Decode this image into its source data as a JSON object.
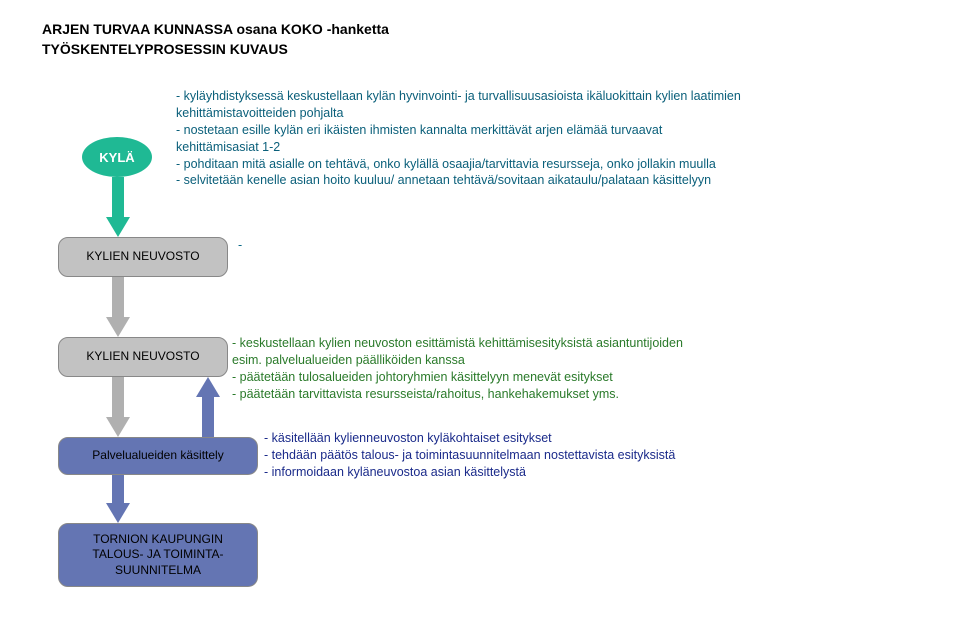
{
  "title_line1": "ARJEN TURVAA KUNNASSA osana KOKO -hanketta",
  "title_line2": "TYÖSKENTELYPROSESSIN KUVAUS",
  "nodes": {
    "kyla": "KYLÄ",
    "neuvosto1": "KYLIEN NEUVOSTO",
    "neuvosto2": "KYLIEN NEUVOSTO",
    "palvelu": "Palvelualueiden käsittely",
    "tornion_l1": "TORNION KAUPUNGIN",
    "tornion_l2": "TALOUS- JA TOIMINTA-",
    "tornion_l3": "SUUNNITELMA"
  },
  "desc": {
    "kyla_l1": "- kyläyhdistyksessä keskustellaan kylän hyvinvointi- ja turvallisuusasioista ikäluokittain kylien laatimien",
    "kyla_l1b": "kehittämistavoitteiden pohjalta",
    "kyla_l2": "- nostetaan esille kylän eri ikäisten ihmisten kannalta merkittävät arjen elämää turvaavat",
    "kyla_l2b": "  kehittämisasiat 1-2",
    "kyla_l3": "- pohditaan mitä asialle on tehtävä, onko kylällä osaajia/tarvittavia resursseja, onko jollakin muulla",
    "kyla_l4": "- selvitetään kenelle asian hoito kuuluu/ annetaan tehtävä/sovitaan aikataulu/palataan käsittelyyn",
    "neu1_dash": "-",
    "neu2_l1": "- keskustellaan kylien neuvoston esittämistä kehittämisesityksistä asiantuntijoiden",
    "neu2_l1b": "  esim. palvelualueiden päälliköiden kanssa",
    "neu2_l2": "- päätetään tulosalueiden johtoryhmien käsittelyyn menevät esitykset",
    "neu2_l3": "- päätetään tarvittavista resursseista/rahoitus, hankehakemukset yms.",
    "palv_l1": "- käsitellään kylienneuvoston kyläkohtaiset esitykset",
    "palv_l2": "- tehdään päätös talous- ja toimintasuunnitelmaan nostettavista esityksistä",
    "palv_l3": "- informoidaan kyläneuvostoa asian käsittelystä"
  },
  "colors": {
    "teal": "#0a5f7a",
    "green": "#2a7a2a",
    "navy": "#1a2a8a",
    "ellipseBg": "#1fb994",
    "blueBox": "#6475b3",
    "grayBox": "#c2c2c2",
    "arrowGreen": "#1fb994",
    "arrowGray": "#b0b0b0",
    "arrowBlue": "#6475b3"
  }
}
